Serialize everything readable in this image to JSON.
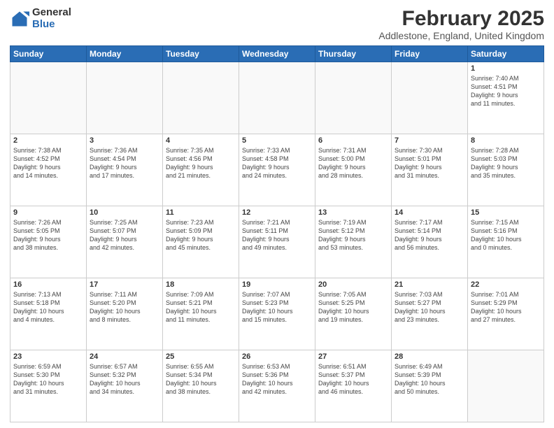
{
  "logo": {
    "general": "General",
    "blue": "Blue"
  },
  "title": "February 2025",
  "subtitle": "Addlestone, England, United Kingdom",
  "headers": [
    "Sunday",
    "Monday",
    "Tuesday",
    "Wednesday",
    "Thursday",
    "Friday",
    "Saturday"
  ],
  "weeks": [
    [
      {
        "num": "",
        "info": ""
      },
      {
        "num": "",
        "info": ""
      },
      {
        "num": "",
        "info": ""
      },
      {
        "num": "",
        "info": ""
      },
      {
        "num": "",
        "info": ""
      },
      {
        "num": "",
        "info": ""
      },
      {
        "num": "1",
        "info": "Sunrise: 7:40 AM\nSunset: 4:51 PM\nDaylight: 9 hours\nand 11 minutes."
      }
    ],
    [
      {
        "num": "2",
        "info": "Sunrise: 7:38 AM\nSunset: 4:52 PM\nDaylight: 9 hours\nand 14 minutes."
      },
      {
        "num": "3",
        "info": "Sunrise: 7:36 AM\nSunset: 4:54 PM\nDaylight: 9 hours\nand 17 minutes."
      },
      {
        "num": "4",
        "info": "Sunrise: 7:35 AM\nSunset: 4:56 PM\nDaylight: 9 hours\nand 21 minutes."
      },
      {
        "num": "5",
        "info": "Sunrise: 7:33 AM\nSunset: 4:58 PM\nDaylight: 9 hours\nand 24 minutes."
      },
      {
        "num": "6",
        "info": "Sunrise: 7:31 AM\nSunset: 5:00 PM\nDaylight: 9 hours\nand 28 minutes."
      },
      {
        "num": "7",
        "info": "Sunrise: 7:30 AM\nSunset: 5:01 PM\nDaylight: 9 hours\nand 31 minutes."
      },
      {
        "num": "8",
        "info": "Sunrise: 7:28 AM\nSunset: 5:03 PM\nDaylight: 9 hours\nand 35 minutes."
      }
    ],
    [
      {
        "num": "9",
        "info": "Sunrise: 7:26 AM\nSunset: 5:05 PM\nDaylight: 9 hours\nand 38 minutes."
      },
      {
        "num": "10",
        "info": "Sunrise: 7:25 AM\nSunset: 5:07 PM\nDaylight: 9 hours\nand 42 minutes."
      },
      {
        "num": "11",
        "info": "Sunrise: 7:23 AM\nSunset: 5:09 PM\nDaylight: 9 hours\nand 45 minutes."
      },
      {
        "num": "12",
        "info": "Sunrise: 7:21 AM\nSunset: 5:11 PM\nDaylight: 9 hours\nand 49 minutes."
      },
      {
        "num": "13",
        "info": "Sunrise: 7:19 AM\nSunset: 5:12 PM\nDaylight: 9 hours\nand 53 minutes."
      },
      {
        "num": "14",
        "info": "Sunrise: 7:17 AM\nSunset: 5:14 PM\nDaylight: 9 hours\nand 56 minutes."
      },
      {
        "num": "15",
        "info": "Sunrise: 7:15 AM\nSunset: 5:16 PM\nDaylight: 10 hours\nand 0 minutes."
      }
    ],
    [
      {
        "num": "16",
        "info": "Sunrise: 7:13 AM\nSunset: 5:18 PM\nDaylight: 10 hours\nand 4 minutes."
      },
      {
        "num": "17",
        "info": "Sunrise: 7:11 AM\nSunset: 5:20 PM\nDaylight: 10 hours\nand 8 minutes."
      },
      {
        "num": "18",
        "info": "Sunrise: 7:09 AM\nSunset: 5:21 PM\nDaylight: 10 hours\nand 11 minutes."
      },
      {
        "num": "19",
        "info": "Sunrise: 7:07 AM\nSunset: 5:23 PM\nDaylight: 10 hours\nand 15 minutes."
      },
      {
        "num": "20",
        "info": "Sunrise: 7:05 AM\nSunset: 5:25 PM\nDaylight: 10 hours\nand 19 minutes."
      },
      {
        "num": "21",
        "info": "Sunrise: 7:03 AM\nSunset: 5:27 PM\nDaylight: 10 hours\nand 23 minutes."
      },
      {
        "num": "22",
        "info": "Sunrise: 7:01 AM\nSunset: 5:29 PM\nDaylight: 10 hours\nand 27 minutes."
      }
    ],
    [
      {
        "num": "23",
        "info": "Sunrise: 6:59 AM\nSunset: 5:30 PM\nDaylight: 10 hours\nand 31 minutes."
      },
      {
        "num": "24",
        "info": "Sunrise: 6:57 AM\nSunset: 5:32 PM\nDaylight: 10 hours\nand 34 minutes."
      },
      {
        "num": "25",
        "info": "Sunrise: 6:55 AM\nSunset: 5:34 PM\nDaylight: 10 hours\nand 38 minutes."
      },
      {
        "num": "26",
        "info": "Sunrise: 6:53 AM\nSunset: 5:36 PM\nDaylight: 10 hours\nand 42 minutes."
      },
      {
        "num": "27",
        "info": "Sunrise: 6:51 AM\nSunset: 5:37 PM\nDaylight: 10 hours\nand 46 minutes."
      },
      {
        "num": "28",
        "info": "Sunrise: 6:49 AM\nSunset: 5:39 PM\nDaylight: 10 hours\nand 50 minutes."
      },
      {
        "num": "",
        "info": ""
      }
    ]
  ]
}
